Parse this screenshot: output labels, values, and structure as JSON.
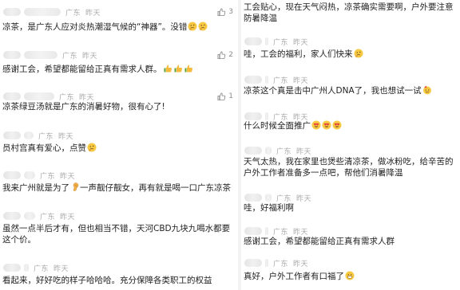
{
  "left_column": {
    "comments": [
      {
        "location": "广东",
        "time": "昨天",
        "likes": "3",
        "text": "凉茶，是广东人应对炎热潮湿气候的“神器”。没错",
        "emoji": [
          "thinking",
          "thinking"
        ]
      },
      {
        "location": "广东",
        "time": "昨天",
        "likes": "2",
        "text": "感谢工会，希望都能留给正真有需求人群。",
        "emoji": [
          "thumbs-up",
          "thumbs-up",
          "thumbs-up"
        ]
      },
      {
        "location": "广东",
        "time": "昨天",
        "likes": "1",
        "text": "凉茶绿豆汤就是广东的消暑好物，很有心了!",
        "emoji": []
      },
      {
        "location": "广东",
        "time": "昨天",
        "likes": "",
        "text": "员村宫真有爱心，点赞",
        "emoji": [
          "thinking"
        ]
      },
      {
        "location": "广东",
        "time": "昨天",
        "likes": "",
        "text_parts": [
          "我来广州就是为了",
          "一声靓仔靓女，再有就是喝一口广东凉茶"
        ],
        "emoji_inline": "ear"
      },
      {
        "location": "广东",
        "time": "昨天",
        "likes": "",
        "text": "虽然一点半后才有，但也相当不错，天河CBD九块九喝水都要这个价。",
        "emoji": []
      },
      {
        "location": "广东",
        "time": "昨天",
        "likes": "",
        "text": "看起来，好好吃的样子哈哈哈。充分保障各类职工的权益",
        "emoji": []
      }
    ]
  },
  "right_column": {
    "comments": [
      {
        "location": "",
        "time": "",
        "likes": "",
        "text": "工会贴心，现在天气闷热，凉茶确实需要啊，户外要注意防暑降温",
        "emoji": []
      },
      {
        "location": "广东",
        "time": "昨天",
        "likes": "",
        "text": "哇，工会的福利，家人们快来",
        "emoji": [
          "thinking"
        ]
      },
      {
        "location": "广东",
        "time": "昨天",
        "likes": "",
        "text": "凉茶这个真是击中广州人DNA了，我也想试一试",
        "emoji": [
          "party"
        ]
      },
      {
        "location": "广东",
        "time": "昨天",
        "likes": "",
        "text": "什么时候全面推广",
        "emoji": [
          "heart-eyes",
          "heart-eyes",
          "heart-eyes"
        ]
      },
      {
        "location": "广东",
        "time": "昨天",
        "likes": "",
        "text": "天气太热，我在家里也煲些清凉茶，做冰粉吃，给辛苦的户外工作者准备多一点吧，帮他们消暑降温",
        "emoji": []
      },
      {
        "location": "广东",
        "time": "昨天",
        "likes": "",
        "text": "哇，好福利啊",
        "emoji": []
      },
      {
        "location": "广东",
        "time": "昨天",
        "likes": "",
        "text": "感谢工会，希望都能留给正真有需求人群",
        "emoji": []
      },
      {
        "location": "广东",
        "time": "昨天",
        "likes": "",
        "text": "真好，户外工作者有口福了",
        "emoji": [
          "grin"
        ]
      }
    ]
  },
  "icons": {
    "like": "thumbs-up-outline-icon"
  },
  "colors": {
    "meta": "#aaaaaa",
    "text": "#222222",
    "background": "#ffffff",
    "blur": "#e8e8e8"
  }
}
